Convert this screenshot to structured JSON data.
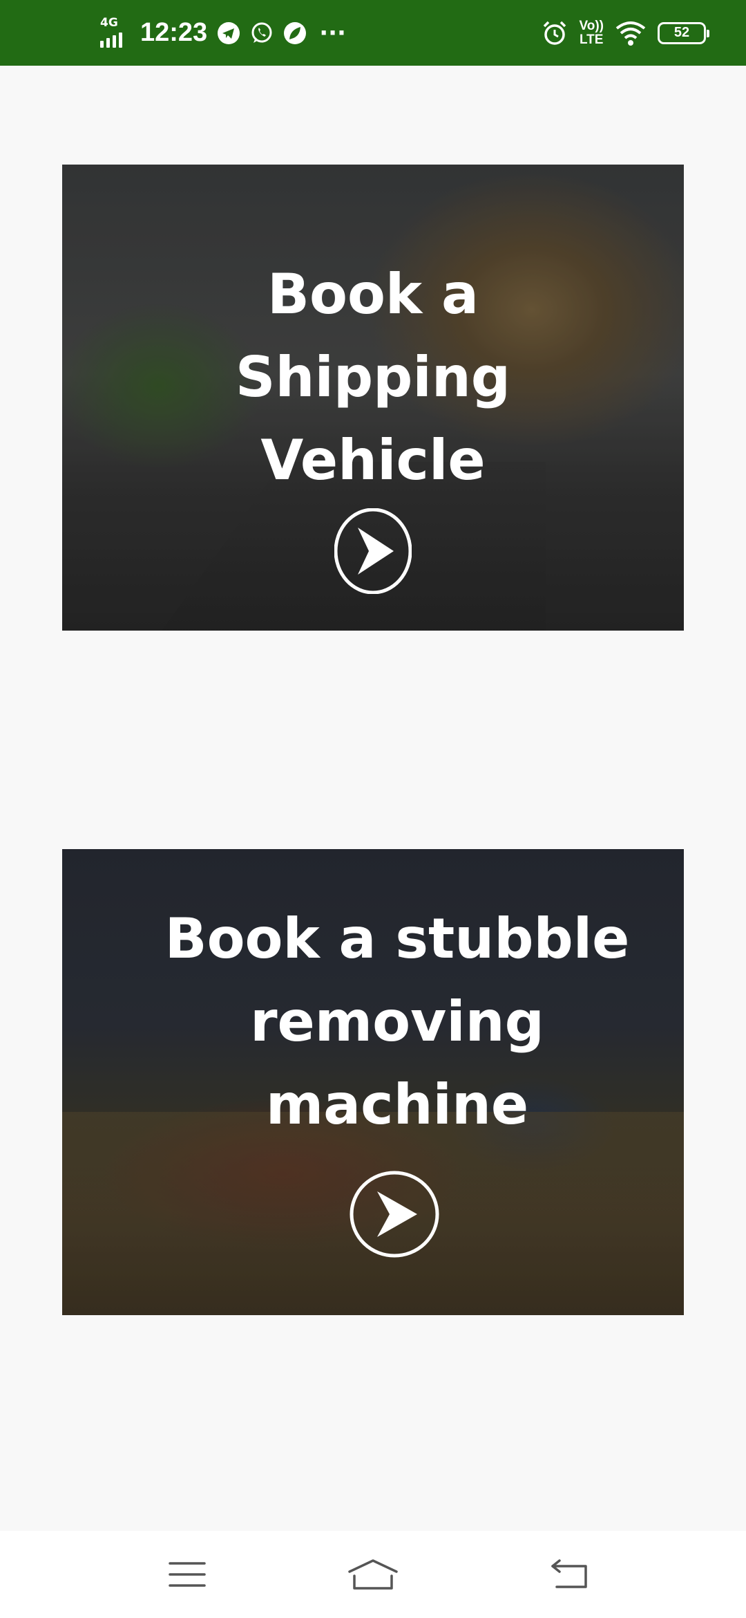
{
  "status_bar": {
    "network": "4G",
    "time": "12:23",
    "overflow": "···",
    "volte_top": "Vo))",
    "volte_bottom": "LTE",
    "battery": "52",
    "background": "#226b14",
    "icons": [
      "signal-icon",
      "telegram-icon",
      "whatsapp-icon",
      "leaf-app-icon",
      "alarm-icon",
      "volte-icon",
      "wifi-icon",
      "battery-icon"
    ]
  },
  "cards": [
    {
      "title": "Book a\nShipping\nVehicle",
      "action_icon": "play-arrow-icon"
    },
    {
      "title": "Book a stubble\nremoving\nmachine",
      "action_icon": "play-arrow-icon"
    }
  ],
  "nav_bar": {
    "icons": [
      "menu-icon",
      "home-icon",
      "back-icon"
    ]
  },
  "colors": {
    "page_background": "#f8f8f8",
    "title_text": "#ffffff",
    "nav_icon": "#555555"
  }
}
